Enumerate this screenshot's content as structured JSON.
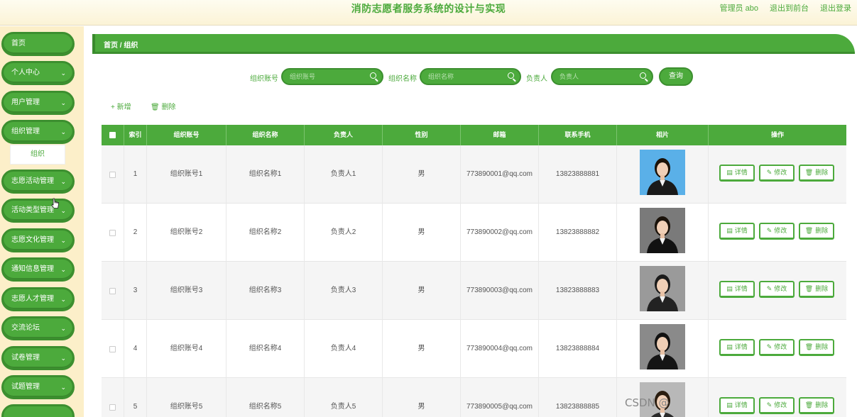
{
  "header": {
    "title": "消防志愿者服务系统的设计与实现",
    "user": "管理员 abo",
    "back_front": "退出到前台",
    "logout": "退出登录"
  },
  "sidebar": {
    "items": [
      {
        "label": "首页",
        "has_arrow": false
      },
      {
        "label": "个人中心",
        "has_arrow": true
      },
      {
        "label": "用户管理",
        "has_arrow": true
      },
      {
        "label": "组织管理",
        "has_arrow": true
      },
      {
        "label": "志愿活动管理",
        "has_arrow": true
      },
      {
        "label": "活动类型管理",
        "has_arrow": true
      },
      {
        "label": "志愿文化管理",
        "has_arrow": true
      },
      {
        "label": "通知信息管理",
        "has_arrow": true
      },
      {
        "label": "志愿人才管理",
        "has_arrow": true
      },
      {
        "label": "交流论坛",
        "has_arrow": true
      },
      {
        "label": "试卷管理",
        "has_arrow": true
      },
      {
        "label": "试题管理",
        "has_arrow": true
      }
    ],
    "submenu": "组织"
  },
  "breadcrumb": "首页 / 组织",
  "search": {
    "account_label": "组织账号",
    "account_placeholder": "组织账号",
    "name_label": "组织名称",
    "name_placeholder": "组织名称",
    "leader_label": "负责人",
    "leader_placeholder": "负责人",
    "query": "查询"
  },
  "actions": {
    "add": "+ 新增",
    "delete": "删除"
  },
  "table": {
    "columns": [
      "",
      "索引",
      "组织账号",
      "组织名称",
      "负责人",
      "性别",
      "邮箱",
      "联系手机",
      "相片",
      "操作"
    ],
    "buttons": {
      "detail": "详情",
      "edit": "修改",
      "delete": "删除"
    },
    "rows": [
      {
        "index": "1",
        "account": "组织账号1",
        "name": "组织名称1",
        "leader": "负责人1",
        "gender": "男",
        "email": "773890001@qq.com",
        "phone": "13823888881"
      },
      {
        "index": "2",
        "account": "组织账号2",
        "name": "组织名称2",
        "leader": "负责人2",
        "gender": "男",
        "email": "773890002@qq.com",
        "phone": "13823888882"
      },
      {
        "index": "3",
        "account": "组织账号3",
        "name": "组织名称3",
        "leader": "负责人3",
        "gender": "男",
        "email": "773890003@qq.com",
        "phone": "13823888883"
      },
      {
        "index": "4",
        "account": "组织账号4",
        "name": "组织名称4",
        "leader": "负责人4",
        "gender": "男",
        "email": "773890004@qq.com",
        "phone": "13823888884"
      },
      {
        "index": "5",
        "account": "组织账号5",
        "name": "组织名称5",
        "leader": "负责人5",
        "gender": "男",
        "email": "773890005@qq.com",
        "phone": "13823888885"
      }
    ]
  },
  "watermark": "CSDN @"
}
